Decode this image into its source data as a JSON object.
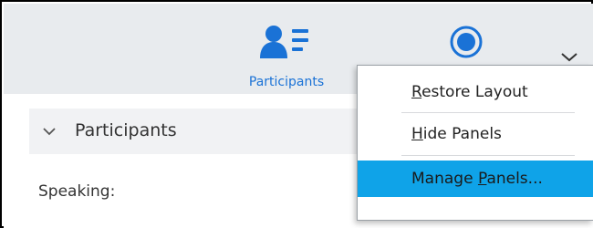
{
  "toolbar": {
    "participants_label": "Participants",
    "participants_icon": "participants-list-icon",
    "record_icon": "record-icon",
    "more_icon": "chevron-down-icon",
    "accent_color": "#1a72d6"
  },
  "panel": {
    "title": "Participants",
    "speaking_label": "Speaking:"
  },
  "menu": {
    "items": [
      {
        "label_pre": "",
        "mnemonic": "R",
        "label_post": "estore Layout"
      },
      {
        "label_pre": "",
        "mnemonic": "H",
        "label_post": "ide Panels"
      },
      {
        "label_pre": "Manage ",
        "mnemonic": "P",
        "label_post": "anels..."
      }
    ],
    "highlight_color": "#0fa3e8"
  }
}
